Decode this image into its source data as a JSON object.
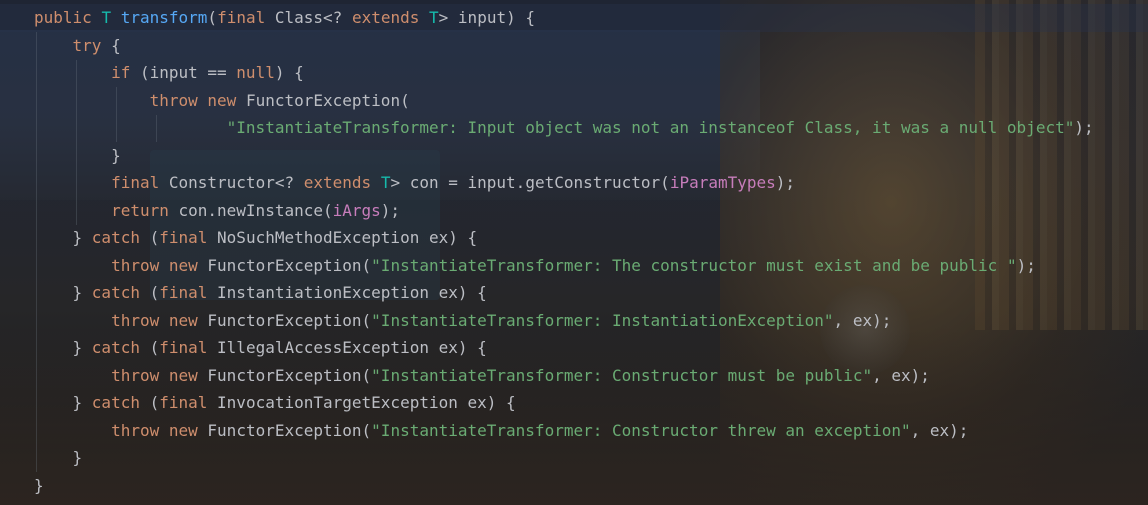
{
  "editor": {
    "theme_colors": {
      "keyword": "#cf8e6d",
      "type_param": "#16baac",
      "method_decl": "#56a8f5",
      "string": "#6aab73",
      "field": "#c77dbb",
      "text": "#bcbec4"
    },
    "lines": [
      {
        "indent": 0,
        "tokens": [
          {
            "t": "public",
            "c": "kw"
          },
          {
            "t": " ",
            "c": "pl"
          },
          {
            "t": "T",
            "c": "tp"
          },
          {
            "t": " ",
            "c": "pl"
          },
          {
            "t": "transform",
            "c": "fn"
          },
          {
            "t": "(",
            "c": "pl"
          },
          {
            "t": "final",
            "c": "kw"
          },
          {
            "t": " Class<? ",
            "c": "pl"
          },
          {
            "t": "extends",
            "c": "kw"
          },
          {
            "t": " ",
            "c": "pl"
          },
          {
            "t": "T",
            "c": "tp"
          },
          {
            "t": "> input) {",
            "c": "pl"
          }
        ]
      },
      {
        "indent": 1,
        "tokens": [
          {
            "t": "try",
            "c": "kw"
          },
          {
            "t": " {",
            "c": "pl"
          }
        ]
      },
      {
        "indent": 2,
        "tokens": [
          {
            "t": "if",
            "c": "kw"
          },
          {
            "t": " (input == ",
            "c": "pl"
          },
          {
            "t": "null",
            "c": "kw"
          },
          {
            "t": ") {",
            "c": "pl"
          }
        ]
      },
      {
        "indent": 3,
        "tokens": [
          {
            "t": "throw",
            "c": "kw"
          },
          {
            "t": " ",
            "c": "pl"
          },
          {
            "t": "new",
            "c": "kw"
          },
          {
            "t": " FunctorException(",
            "c": "pl"
          }
        ]
      },
      {
        "indent": 5,
        "tokens": [
          {
            "t": "\"InstantiateTransformer: Input object was not an instanceof Class, it was a null object\"",
            "c": "str"
          },
          {
            "t": ");",
            "c": "pl"
          }
        ]
      },
      {
        "indent": 2,
        "tokens": [
          {
            "t": "}",
            "c": "pl"
          }
        ]
      },
      {
        "indent": 2,
        "tokens": [
          {
            "t": "final",
            "c": "kw"
          },
          {
            "t": " Constructor<? ",
            "c": "pl"
          },
          {
            "t": "extends",
            "c": "kw"
          },
          {
            "t": " ",
            "c": "pl"
          },
          {
            "t": "T",
            "c": "tp"
          },
          {
            "t": "> con = input.getConstructor(",
            "c": "pl"
          },
          {
            "t": "iParamTypes",
            "c": "fld"
          },
          {
            "t": ");",
            "c": "pl"
          }
        ]
      },
      {
        "indent": 2,
        "tokens": [
          {
            "t": "return",
            "c": "kw"
          },
          {
            "t": " con.newInstance(",
            "c": "pl"
          },
          {
            "t": "iArgs",
            "c": "fld"
          },
          {
            "t": ");",
            "c": "pl"
          }
        ]
      },
      {
        "indent": 1,
        "tokens": [
          {
            "t": "} ",
            "c": "pl"
          },
          {
            "t": "catch",
            "c": "kw"
          },
          {
            "t": " (",
            "c": "pl"
          },
          {
            "t": "final",
            "c": "kw"
          },
          {
            "t": " NoSuchMethodException ex) {",
            "c": "pl"
          }
        ]
      },
      {
        "indent": 2,
        "tokens": [
          {
            "t": "throw",
            "c": "kw"
          },
          {
            "t": " ",
            "c": "pl"
          },
          {
            "t": "new",
            "c": "kw"
          },
          {
            "t": " FunctorException(",
            "c": "pl"
          },
          {
            "t": "\"InstantiateTransformer: The constructor must exist and be public \"",
            "c": "str"
          },
          {
            "t": ");",
            "c": "pl"
          }
        ]
      },
      {
        "indent": 1,
        "tokens": [
          {
            "t": "} ",
            "c": "pl"
          },
          {
            "t": "catch",
            "c": "kw"
          },
          {
            "t": " (",
            "c": "pl"
          },
          {
            "t": "final",
            "c": "kw"
          },
          {
            "t": " InstantiationException ex) {",
            "c": "pl"
          }
        ]
      },
      {
        "indent": 2,
        "tokens": [
          {
            "t": "throw",
            "c": "kw"
          },
          {
            "t": " ",
            "c": "pl"
          },
          {
            "t": "new",
            "c": "kw"
          },
          {
            "t": " FunctorException(",
            "c": "pl"
          },
          {
            "t": "\"InstantiateTransformer: InstantiationException\"",
            "c": "str"
          },
          {
            "t": ", ex);",
            "c": "pl"
          }
        ]
      },
      {
        "indent": 1,
        "tokens": [
          {
            "t": "} ",
            "c": "pl"
          },
          {
            "t": "catch",
            "c": "kw"
          },
          {
            "t": " (",
            "c": "pl"
          },
          {
            "t": "final",
            "c": "kw"
          },
          {
            "t": " IllegalAccessException ex) {",
            "c": "pl"
          }
        ]
      },
      {
        "indent": 2,
        "tokens": [
          {
            "t": "throw",
            "c": "kw"
          },
          {
            "t": " ",
            "c": "pl"
          },
          {
            "t": "new",
            "c": "kw"
          },
          {
            "t": " FunctorException(",
            "c": "pl"
          },
          {
            "t": "\"InstantiateTransformer: Constructor must be public\"",
            "c": "str"
          },
          {
            "t": ", ex);",
            "c": "pl"
          }
        ]
      },
      {
        "indent": 1,
        "tokens": [
          {
            "t": "} ",
            "c": "pl"
          },
          {
            "t": "catch",
            "c": "kw"
          },
          {
            "t": " (",
            "c": "pl"
          },
          {
            "t": "final",
            "c": "kw"
          },
          {
            "t": " InvocationTargetException ex) {",
            "c": "pl"
          }
        ]
      },
      {
        "indent": 2,
        "tokens": [
          {
            "t": "throw",
            "c": "kw"
          },
          {
            "t": " ",
            "c": "pl"
          },
          {
            "t": "new",
            "c": "kw"
          },
          {
            "t": " FunctorException(",
            "c": "pl"
          },
          {
            "t": "\"InstantiateTransformer: Constructor threw an exception\"",
            "c": "str"
          },
          {
            "t": ", ex);",
            "c": "pl"
          }
        ]
      },
      {
        "indent": 1,
        "tokens": [
          {
            "t": "}",
            "c": "pl"
          }
        ]
      },
      {
        "indent": 0,
        "tokens": [
          {
            "t": "}",
            "c": "pl"
          }
        ]
      }
    ]
  }
}
